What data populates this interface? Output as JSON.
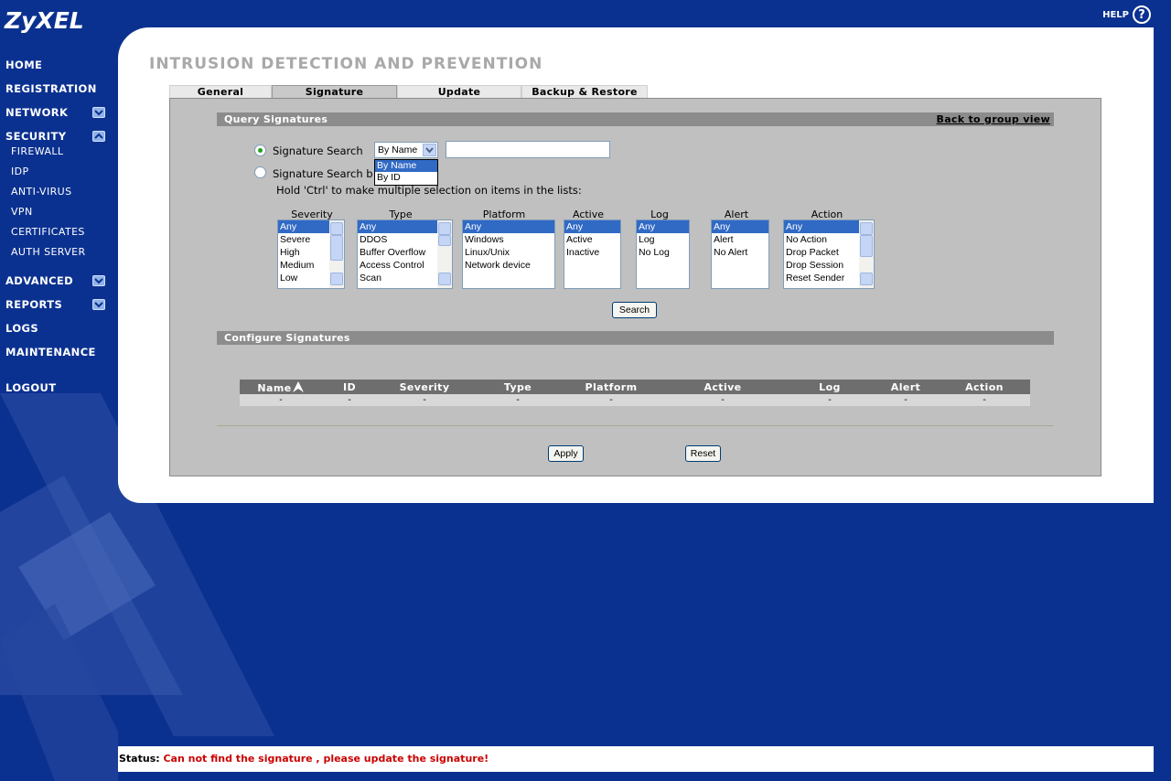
{
  "brand": {
    "logo_text": "ZyXEL"
  },
  "header": {
    "help_label": "HELP"
  },
  "nav": {
    "home": "HOME",
    "registration": "REGISTRATION",
    "network": "NETWORK",
    "security": "SECURITY",
    "security_items": [
      "FIREWALL",
      "IDP",
      "ANTI-VIRUS",
      "VPN",
      "CERTIFICATES",
      "AUTH SERVER"
    ],
    "advanced": "ADVANCED",
    "reports": "REPORTS",
    "logs": "LOGS",
    "maintenance": "MAINTENANCE",
    "logout": "LOGOUT"
  },
  "page": {
    "title": "INTRUSION DETECTION AND PREVENTION"
  },
  "tabs": [
    {
      "label": "General",
      "active": false
    },
    {
      "label": "Signature",
      "active": true
    },
    {
      "label": "Update",
      "active": false
    },
    {
      "label": "Backup & Restore",
      "active": false
    }
  ],
  "query": {
    "section_title": "Query Signatures",
    "back_link": "Back to group view",
    "radio_search_label": "Signature Search",
    "radio_attr_label": "Signature Search b",
    "search_by_value": "By Name",
    "search_by_options": [
      "By Name",
      "By ID"
    ],
    "search_input_value": "",
    "hint": "Hold 'Ctrl' to make multiple selection on items in the lists:",
    "search_button": "Search"
  },
  "lists": {
    "severity": {
      "label": "Severity",
      "options": [
        "Any",
        "Severe",
        "High",
        "Medium",
        "Low"
      ]
    },
    "type": {
      "label": "Type",
      "options": [
        "Any",
        "DDOS",
        "Buffer Overflow",
        "Access Control",
        "Scan"
      ]
    },
    "platform": {
      "label": "Platform",
      "options": [
        "Any",
        "Windows",
        "Linux/Unix",
        "Network device"
      ]
    },
    "active": {
      "label": "Active",
      "options": [
        "Any",
        "Active",
        "Inactive"
      ]
    },
    "log": {
      "label": "Log",
      "options": [
        "Any",
        "Log",
        "No Log"
      ]
    },
    "alert": {
      "label": "Alert",
      "options": [
        "Any",
        "Alert",
        "No Alert"
      ]
    },
    "action": {
      "label": "Action",
      "options": [
        "Any",
        "No Action",
        "Drop Packet",
        "Drop Session",
        "Reset Sender"
      ]
    }
  },
  "configure": {
    "section_title": "Configure Signatures",
    "columns": [
      "Name",
      "ID",
      "Severity",
      "Type",
      "Platform",
      "Active",
      "Log",
      "Alert",
      "Action"
    ],
    "rows": [
      [
        "-",
        "-",
        "-",
        "-",
        "-",
        "-",
        "-",
        "-",
        "-"
      ]
    ],
    "apply_button": "Apply",
    "reset_button": "Reset"
  },
  "status": {
    "label": "Status:",
    "message": "Can not find the signature , please update the signature!"
  },
  "colors": {
    "background": "#0b3190",
    "status_error": "#cc0000",
    "selection": "#316ac5"
  }
}
